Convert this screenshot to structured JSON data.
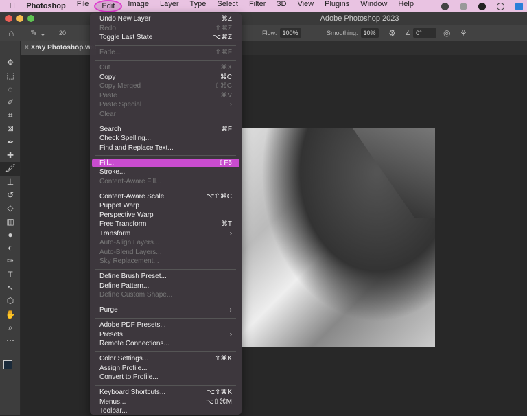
{
  "menubar": {
    "apple": "",
    "app": "Photoshop",
    "items": [
      "File",
      "Edit",
      "Image",
      "Layer",
      "Type",
      "Select",
      "Filter",
      "3D",
      "View",
      "Plugins",
      "Window",
      "Help"
    ]
  },
  "window": {
    "title": "Adobe Photoshop 2023"
  },
  "options": {
    "brush_size": "20",
    "flow_label": "Flow:",
    "flow_value": "100%",
    "smoothing_label": "Smoothing:",
    "smoothing_value": "10%",
    "angle_value": "0°"
  },
  "document": {
    "tab_title": "Xray Photoshop.webp"
  },
  "colors": {
    "highlight": "#c94ccf",
    "menubar": "#e9c3e2"
  },
  "edit_menu": [
    [
      {
        "label": "Undo New Layer",
        "sc": "⌘Z"
      },
      {
        "label": "Redo",
        "sc": "⇧⌘Z",
        "dis": true
      },
      {
        "label": "Toggle Last State",
        "sc": "⌥⌘Z"
      }
    ],
    [
      {
        "label": "Fade...",
        "sc": "⇧⌘F",
        "dis": true
      }
    ],
    [
      {
        "label": "Cut",
        "sc": "⌘X",
        "dis": true
      },
      {
        "label": "Copy",
        "sc": "⌘C"
      },
      {
        "label": "Copy Merged",
        "sc": "⇧⌘C",
        "dis": true
      },
      {
        "label": "Paste",
        "sc": "⌘V",
        "dis": true
      },
      {
        "label": "Paste Special",
        "sc": "›",
        "dis": true
      },
      {
        "label": "Clear",
        "sc": "",
        "dis": true
      }
    ],
    [
      {
        "label": "Search",
        "sc": "⌘F"
      },
      {
        "label": "Check Spelling...",
        "sc": ""
      },
      {
        "label": "Find and Replace Text...",
        "sc": ""
      }
    ],
    [
      {
        "label": "Fill...",
        "sc": "⇧F5",
        "hl": true
      },
      {
        "label": "Stroke...",
        "sc": ""
      },
      {
        "label": "Content-Aware Fill...",
        "sc": "",
        "dis": true
      }
    ],
    [
      {
        "label": "Content-Aware Scale",
        "sc": "⌥⇧⌘C"
      },
      {
        "label": "Puppet Warp",
        "sc": ""
      },
      {
        "label": "Perspective Warp",
        "sc": ""
      },
      {
        "label": "Free Transform",
        "sc": "⌘T"
      },
      {
        "label": "Transform",
        "sc": "›"
      },
      {
        "label": "Auto-Align Layers...",
        "sc": "",
        "dis": true
      },
      {
        "label": "Auto-Blend Layers...",
        "sc": "",
        "dis": true
      },
      {
        "label": "Sky Replacement...",
        "sc": "",
        "dis": true
      }
    ],
    [
      {
        "label": "Define Brush Preset...",
        "sc": ""
      },
      {
        "label": "Define Pattern...",
        "sc": ""
      },
      {
        "label": "Define Custom Shape...",
        "sc": "",
        "dis": true
      }
    ],
    [
      {
        "label": "Purge",
        "sc": "›"
      }
    ],
    [
      {
        "label": "Adobe PDF Presets...",
        "sc": ""
      },
      {
        "label": "Presets",
        "sc": "›"
      },
      {
        "label": "Remote Connections...",
        "sc": ""
      }
    ],
    [
      {
        "label": "Color Settings...",
        "sc": "⇧⌘K"
      },
      {
        "label": "Assign Profile...",
        "sc": ""
      },
      {
        "label": "Convert to Profile...",
        "sc": ""
      }
    ],
    [
      {
        "label": "Keyboard Shortcuts...",
        "sc": "⌥⇧⌘K"
      },
      {
        "label": "Menus...",
        "sc": "⌥⇧⌘M"
      },
      {
        "label": "Toolbar...",
        "sc": ""
      }
    ]
  ],
  "tools": [
    "move",
    "marquee",
    "lasso",
    "quick-select",
    "crop",
    "frame",
    "eyedropper",
    "healing",
    "brush",
    "stamp",
    "history-brush",
    "eraser",
    "gradient",
    "blur",
    "dodge",
    "pen",
    "type",
    "path-select",
    "shape",
    "hand",
    "zoom",
    "more"
  ]
}
